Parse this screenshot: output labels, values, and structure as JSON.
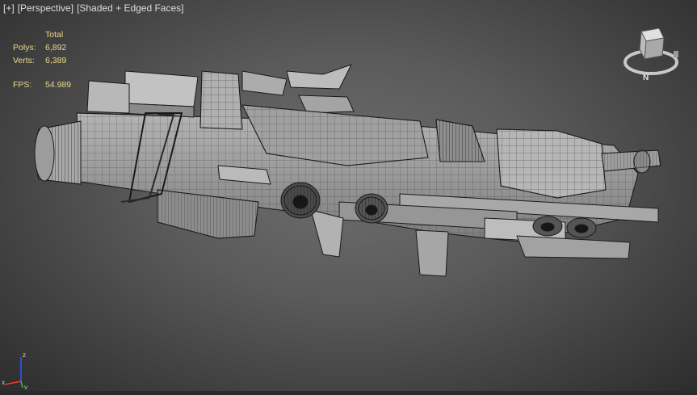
{
  "viewport": {
    "labels": [
      "[+]",
      "[Perspective]",
      "[Shaded + Edged Faces]"
    ]
  },
  "stats": {
    "header": "Total",
    "polys_label": "Polys:",
    "polys_value": "6,892",
    "verts_label": "Verts:",
    "verts_value": "6,389",
    "fps_label": "FPS:",
    "fps_value": "54.989"
  },
  "viewcube": {
    "compass_label": "N"
  },
  "axis": {
    "x_label": "x",
    "y_label": "y",
    "z_label": "z"
  },
  "colors": {
    "stats_text": "#e8d98a",
    "header_text": "#dcdcdc",
    "mesh_fill": "#9a9a9a",
    "mesh_edge": "#1a1a1a",
    "background": "#5a5a5a"
  }
}
